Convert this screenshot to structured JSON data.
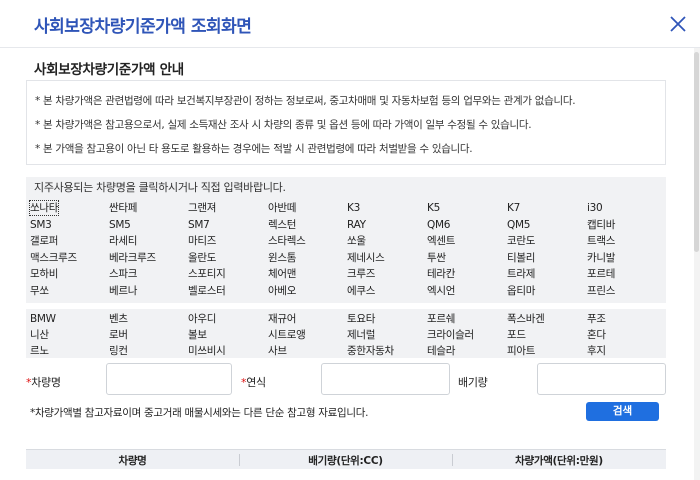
{
  "header": {
    "title": "사회보장차량기준가액 조회화면"
  },
  "guide": {
    "title": "사회보장차량기준가액 안내",
    "notices": [
      "* 본 차량가액은 관련법령에 따라 보건복지부장관이 정하는 정보로써, 중고차매매 및 자동차보험 등의 업무와는 관계가 없습니다.",
      "* 본 차량가액은 참고용으로서, 실제 소득재산 조사 시 차량의 종류 및 옵션 등에 따라 가액이 일부 수정될 수 있습니다.",
      "* 본 가액을 참고용이 아닌 타 용도로 활용하는 경우에는 적발 시 관련법령에 따라 처벌받을 수 있습니다."
    ]
  },
  "car_select": {
    "hint": "지주사용되는 차량명을 클릭하시거나 직접 입력바랍니다.",
    "domestic_rows": [
      [
        "쏘나타",
        "싼타페",
        "그랜져",
        "아반떼",
        "K3",
        "K5",
        "K7",
        "i30"
      ],
      [
        "SM3",
        "SM5",
        "SM7",
        "렉스턴",
        "RAY",
        "QM6",
        "QM5",
        "캡티바"
      ],
      [
        "갤로퍼",
        "라세티",
        "마티즈",
        "스타렉스",
        "쏘울",
        "엑센트",
        "코란도",
        "트랙스"
      ],
      [
        "맥스크루즈",
        "베라크루즈",
        "올란도",
        "윈스톰",
        "제네시스",
        "투싼",
        "티볼리",
        "카니발"
      ],
      [
        "모하비",
        "스파크",
        "스포티지",
        "체어맨",
        "크루즈",
        "테라칸",
        "트라제",
        "포르테"
      ],
      [
        "무쏘",
        "베르나",
        "벨로스터",
        "아베오",
        "에쿠스",
        "엑시언",
        "옵티마",
        "프린스"
      ]
    ],
    "import_rows": [
      [
        "BMW",
        "벤츠",
        "아우디",
        "재규어",
        "토요타",
        "포르쉐",
        "폭스바겐",
        "푸조"
      ],
      [
        "니산",
        "로버",
        "볼보",
        "시트로앵",
        "제너럴",
        "크라이슬러",
        "포드",
        "혼다"
      ],
      [
        "르노",
        "링컨",
        "미쓰비시",
        "사브",
        "중한자동차",
        "테슬라",
        "피아트",
        "후지"
      ]
    ]
  },
  "form": {
    "required_mark": "*",
    "car_name_label": "차량명",
    "year_label": "연식",
    "displacement_label": "배기량",
    "car_name_value": "",
    "year_value": "",
    "displacement_value": ""
  },
  "note": "*차량가액별 참고자료이며 중고거래 매물시세와는 다른 단순 참고형 자료입니다.",
  "search_button": "검색",
  "table": {
    "columns": [
      "차량명",
      "배기량(단위:CC)",
      "차량가액(단위:만원)"
    ]
  },
  "colors": {
    "title": "#2f55b8",
    "button": "#1f6fe0",
    "required": "#dd1111"
  },
  "icons": {
    "close": "close-icon"
  }
}
